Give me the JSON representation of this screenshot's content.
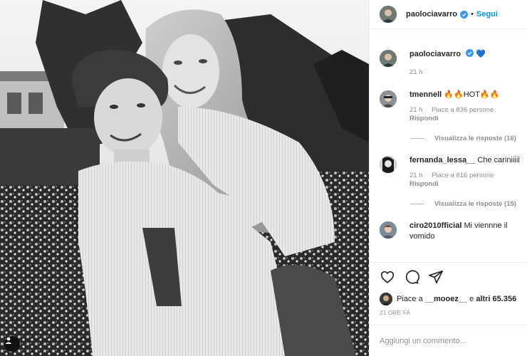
{
  "post": {
    "author": "paolociavarro",
    "follow_label": "Segui",
    "dot": "•"
  },
  "caption": {
    "username": "paolociavarro",
    "text": "💙",
    "time": "21 h"
  },
  "comments": [
    {
      "username": "tmennell",
      "text": "🔥🔥HOT🔥🔥",
      "time": "21 h",
      "likes": "Piace a 836 persone",
      "reply": "Rispondi",
      "view_replies": "Visualizza le risposte (16)"
    },
    {
      "username": "fernanda_lessa__",
      "text": "Che cariniiiii",
      "time": "21 h",
      "likes": "Piace a 816 persone",
      "reply": "Rispondi",
      "view_replies": "Visualizza le risposte (15)"
    },
    {
      "username": "ciro2010fficial",
      "text": "Mi viennne il vomido"
    }
  ],
  "likes_line": {
    "prefix": "Piace a",
    "user": "__mooez__",
    "middle": "e",
    "others": "altri 65.356"
  },
  "timestamp": "21 ORE FA",
  "add_comment": {
    "placeholder": "Aggiungi un commento..."
  },
  "colors": {
    "accent": "#0095f6",
    "verified": "#3897f0",
    "text": "#262626",
    "muted": "#8e8e8e"
  },
  "icons": [
    "heart-icon",
    "comment-icon",
    "share-icon",
    "verified-icon",
    "user-tag-icon"
  ]
}
